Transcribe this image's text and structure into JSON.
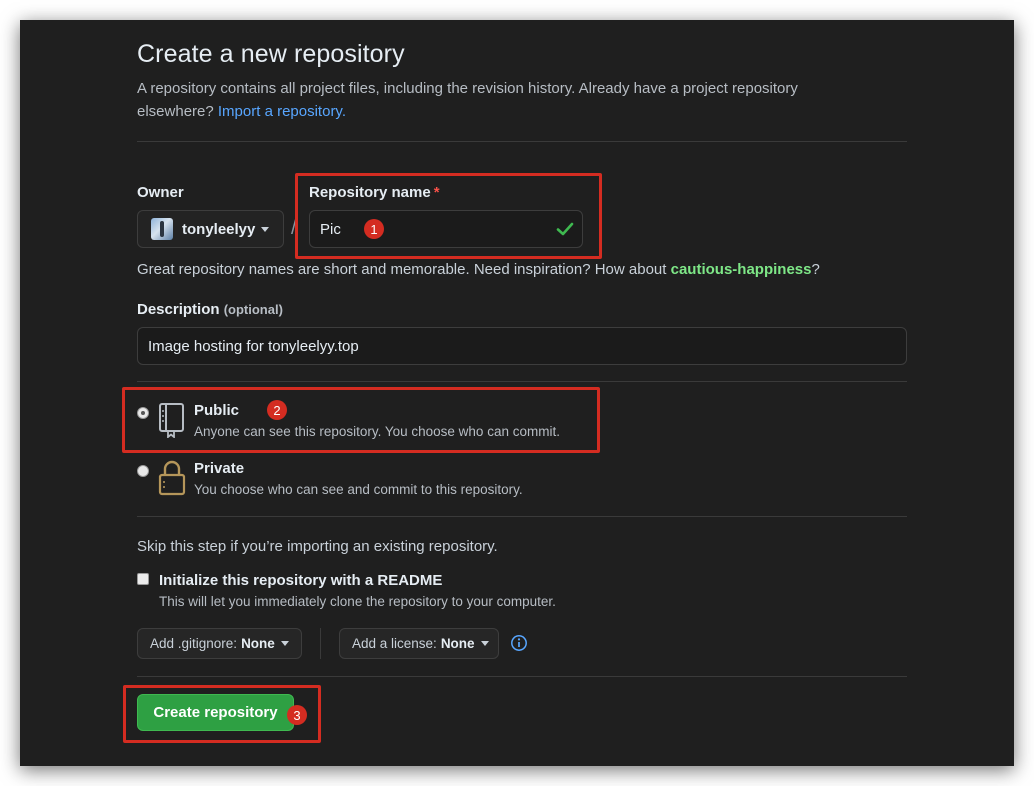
{
  "header": {
    "title": "Create a new repository",
    "subtitle": "A repository contains all project files, including the revision history. Already have a project repository elsewhere?",
    "import_link": "Import a repository."
  },
  "owner": {
    "label": "Owner",
    "value": "tonyleelyy"
  },
  "repo_name": {
    "label": "Repository name",
    "required_mark": "*",
    "value": "Pic",
    "separator": "/"
  },
  "hint": {
    "text": "Great repository names are short and memorable. Need inspiration? How about",
    "suggestion": "cautious-happiness",
    "suffix": "?"
  },
  "description": {
    "label": "Description",
    "optional": "(optional)",
    "value": "Image hosting for tonyleelyy.top"
  },
  "visibility": {
    "public": {
      "title": "Public",
      "desc": "Anyone can see this repository. You choose who can commit.",
      "selected": true
    },
    "private": {
      "title": "Private",
      "desc": "You choose who can see and commit to this repository.",
      "selected": false
    }
  },
  "init": {
    "skip_text": "Skip this step if you’re importing an existing repository.",
    "readme_label": "Initialize this repository with a README",
    "readme_desc": "This will let you immediately clone the repository to your computer."
  },
  "gitignore": {
    "label": "Add .gitignore:",
    "value": "None"
  },
  "license": {
    "label": "Add a license:",
    "value": "None"
  },
  "create_button": "Create repository",
  "annotations": {
    "one": "1",
    "two": "2",
    "three": "3"
  },
  "colors": {
    "accent_green": "#2ea043",
    "link_blue": "#58a6ff",
    "annotation_red": "#d42c21",
    "suggestion_green": "#7ee787"
  }
}
